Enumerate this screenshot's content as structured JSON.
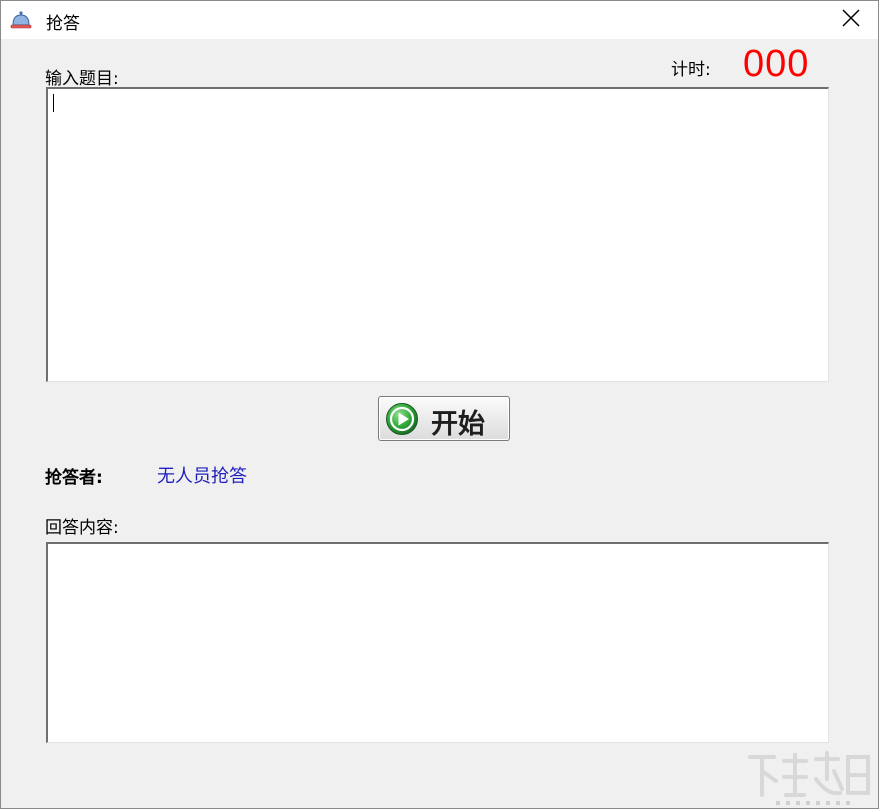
{
  "window": {
    "title": "抢答",
    "title_icon": "bell-icon",
    "close_icon": "close-icon"
  },
  "question": {
    "label": "输入题目:",
    "value": ""
  },
  "timer": {
    "label": "计时:",
    "value": "000",
    "color": "#ff0000"
  },
  "start_button": {
    "label": "开始",
    "icon": "play-icon"
  },
  "responder": {
    "label": "抢答者:",
    "value": "无人员抢答",
    "value_color": "#1f1fbf"
  },
  "answer": {
    "label": "回答内容:",
    "value": ""
  },
  "watermark": {
    "icon": "watermark-logo"
  }
}
